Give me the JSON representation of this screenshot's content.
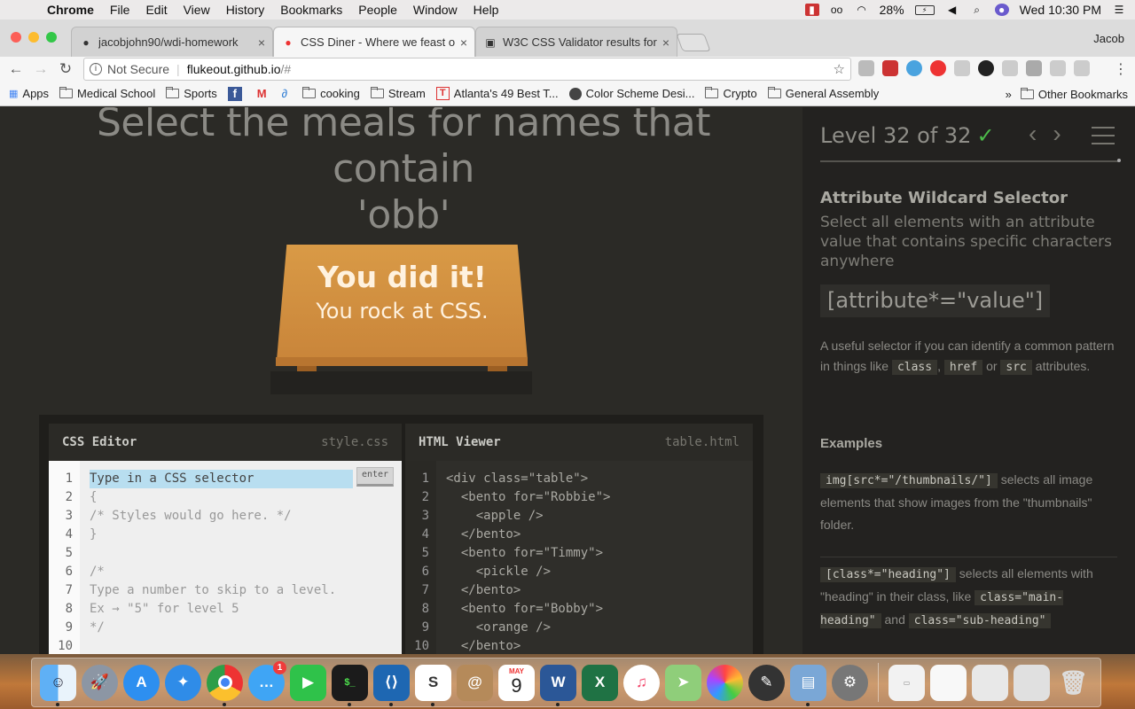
{
  "menubar": {
    "app": "Chrome",
    "items": [
      "File",
      "Edit",
      "View",
      "History",
      "Bookmarks",
      "People",
      "Window",
      "Help"
    ],
    "battery": "28%",
    "clock": "Wed 10:30 PM"
  },
  "tabs": [
    {
      "title": "jacobjohn90/wdi-homework"
    },
    {
      "title": "CSS Diner - Where we feast on"
    },
    {
      "title": "W3C CSS Validator results for"
    }
  ],
  "profile": "Jacob",
  "omnibox": {
    "security": "Not Secure",
    "separator": "|",
    "host": "flukeout.github.io",
    "path": "/#"
  },
  "bookmarks": {
    "items": [
      "Apps",
      "Medical School",
      "Sports",
      "cooking",
      "Stream",
      "Atlanta's 49 Best T...",
      "Color Scheme Desi...",
      "Crypto",
      "General Assembly"
    ],
    "overflow": "»",
    "other": "Other Bookmarks"
  },
  "game": {
    "order_line1": "Select the meals for names that contain",
    "order_line2": "'obb'",
    "win_line1": "You did it!",
    "win_line2": "You rock at CSS."
  },
  "css_editor": {
    "title": "CSS Editor",
    "file": "style.css",
    "enter_label": "enter",
    "line_numbers": [
      "1",
      "2",
      "3",
      "4",
      "5",
      "6",
      "7",
      "8",
      "9",
      "10"
    ],
    "input_placeholder": "Type in a CSS selector",
    "lines": [
      "{",
      "/* Styles would go here. */",
      "}",
      "",
      "/*",
      "Type a number to skip to a level.",
      "Ex → \"5\" for level 5",
      "*/",
      ""
    ]
  },
  "html_viewer": {
    "title": "HTML Viewer",
    "file": "table.html",
    "line_numbers": [
      "1",
      "2",
      "3",
      "4",
      "5",
      "6",
      "7",
      "8",
      "9",
      "10"
    ],
    "lines": [
      "<div class=\"table\">",
      "  <bento for=\"Robbie\">",
      "    <apple />",
      "  </bento>",
      "  <bento for=\"Timmy\">",
      "    <pickle />",
      "  </bento>",
      "  <bento for=\"Bobby\">",
      "    <orange />",
      "  </bento>"
    ]
  },
  "sidebar": {
    "level": "Level 32 of 32",
    "check": "✓",
    "title": "Attribute Wildcard Selector",
    "description": "Select all elements with an attribute value that contains specific characters anywhere",
    "syntax": "[attribute*=\"value\"]",
    "help_prefix": "A useful selector if you can identify a common pattern in things like",
    "help_code1": "class",
    "help_comma": ",",
    "help_code2": "href",
    "help_or": "or",
    "help_code3": "src",
    "help_suffix": "attributes.",
    "examples_title": "Examples",
    "ex1_code": "img[src*=\"/thumbnails/\"]",
    "ex1_text": "selects all image elements that show images from the \"thumbnails\" folder.",
    "ex2_code": "[class*=\"heading\"]",
    "ex2_text": "selects all elements with \"heading\" in their class, like",
    "ex2_code2": "class=\"main-heading\"",
    "ex2_and": "and",
    "ex2_code3": "class=\"sub-heading\""
  },
  "dock": {
    "messages_badge": "1",
    "calendar_month": "MAY",
    "calendar_day": "9",
    "icons": [
      "finder-icon",
      "launchpad-icon",
      "app-store-icon",
      "safari-icon",
      "chrome-icon",
      "messages-icon",
      "facetime-icon",
      "terminal-icon",
      "vscode-icon",
      "slack-icon",
      "contacts-icon",
      "calendar-icon",
      "word-icon",
      "excel-icon",
      "itunes-icon",
      "maps-icon",
      "photos-icon",
      "dictionary-icon",
      "preview-icon",
      "system-preferences-icon"
    ]
  }
}
